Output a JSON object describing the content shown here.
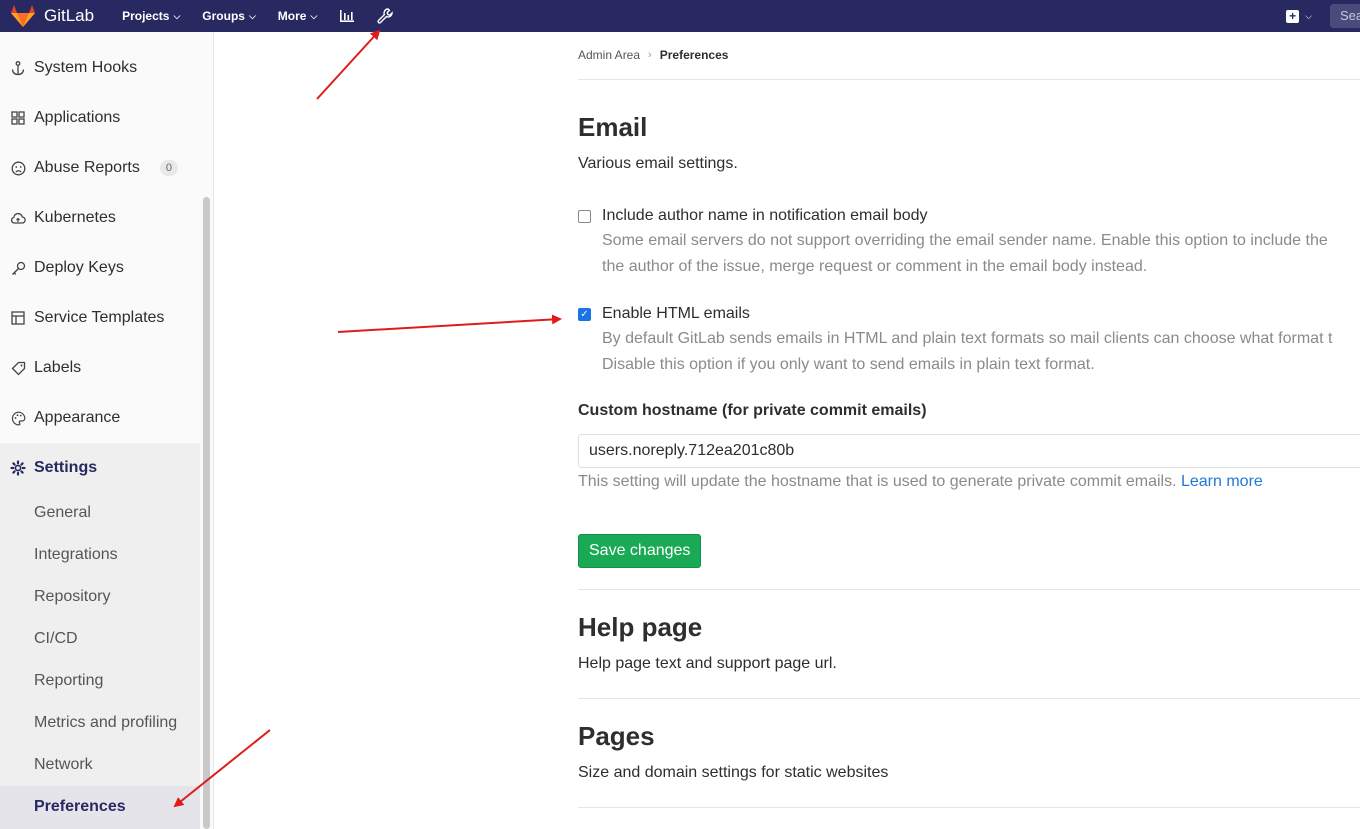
{
  "navbar": {
    "brand": "GitLab",
    "menu": [
      {
        "label": "Projects"
      },
      {
        "label": "Groups"
      },
      {
        "label": "More"
      }
    ],
    "search_placeholder": "Sea"
  },
  "sidebar": {
    "items": [
      {
        "label": "System Hooks",
        "icon": "anchor-icon"
      },
      {
        "label": "Applications",
        "icon": "grid-icon"
      },
      {
        "label": "Abuse Reports",
        "icon": "frown-icon",
        "badge": "0"
      },
      {
        "label": "Kubernetes",
        "icon": "cloud-icon"
      },
      {
        "label": "Deploy Keys",
        "icon": "key-icon"
      },
      {
        "label": "Service Templates",
        "icon": "template-icon"
      },
      {
        "label": "Labels",
        "icon": "tag-icon"
      },
      {
        "label": "Appearance",
        "icon": "palette-icon"
      }
    ],
    "settings": {
      "label": "Settings",
      "icon": "gear-icon",
      "sub_items": [
        "General",
        "Integrations",
        "Repository",
        "CI/CD",
        "Reporting",
        "Metrics and profiling",
        "Network",
        "Preferences"
      ],
      "active_sub": "Preferences"
    }
  },
  "breadcrumb": {
    "parent": "Admin Area",
    "current": "Preferences"
  },
  "email": {
    "title": "Email",
    "description": "Various email settings.",
    "author_name": {
      "label": "Include author name in notification email body",
      "checked": false,
      "help_line1": "Some email servers do not support overriding the email sender name. Enable this option to include the",
      "help_line2": "the author of the issue, merge request or comment in the email body instead."
    },
    "html_emails": {
      "label": "Enable HTML emails",
      "checked": true,
      "help_line1": "By default GitLab sends emails in HTML and plain text formats so mail clients can choose what format t",
      "help_line2": "Disable this option if you only want to send emails in plain text format."
    },
    "hostname": {
      "label": "Custom hostname (for private commit emails)",
      "value": "users.noreply.712ea201c80b",
      "help": "This setting will update the hostname that is used to generate private commit emails.",
      "learn_more": "Learn more"
    },
    "save_label": "Save changes"
  },
  "help_page": {
    "title": "Help page",
    "description": "Help page text and support page url."
  },
  "pages": {
    "title": "Pages",
    "description": "Size and domain settings for static websites"
  },
  "colors": {
    "navbar": "#292961",
    "save_button": "#1aaa55",
    "link": "#1f78d1",
    "annotation_arrow": "#e01b1b"
  }
}
